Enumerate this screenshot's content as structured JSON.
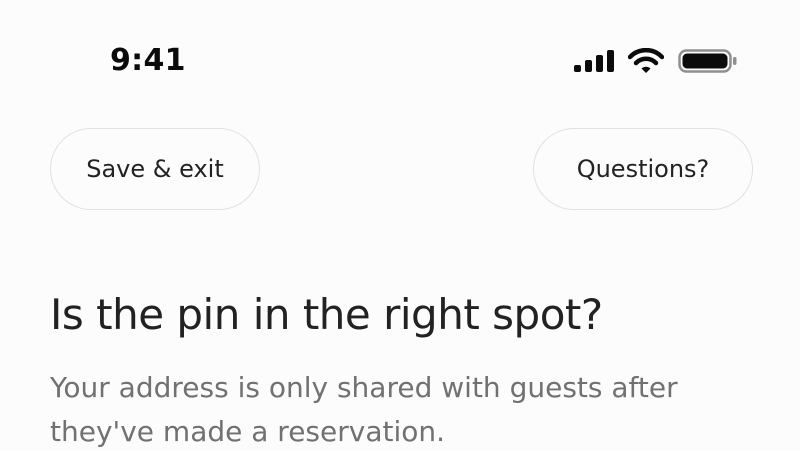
{
  "status_bar": {
    "time": "9:41",
    "icons": [
      "cellular-signal-icon",
      "wifi-icon",
      "battery-icon"
    ]
  },
  "header": {
    "save_exit_label": "Save & exit",
    "questions_label": "Questions?"
  },
  "content": {
    "title": "Is the pin in the right spot?",
    "subtitle": "Your address is only shared with guests after they've made a reservation."
  },
  "colors": {
    "background": "#fdfcfd",
    "text_primary": "#222222",
    "text_secondary": "#717171",
    "pill_border": "#e1e1e1"
  }
}
